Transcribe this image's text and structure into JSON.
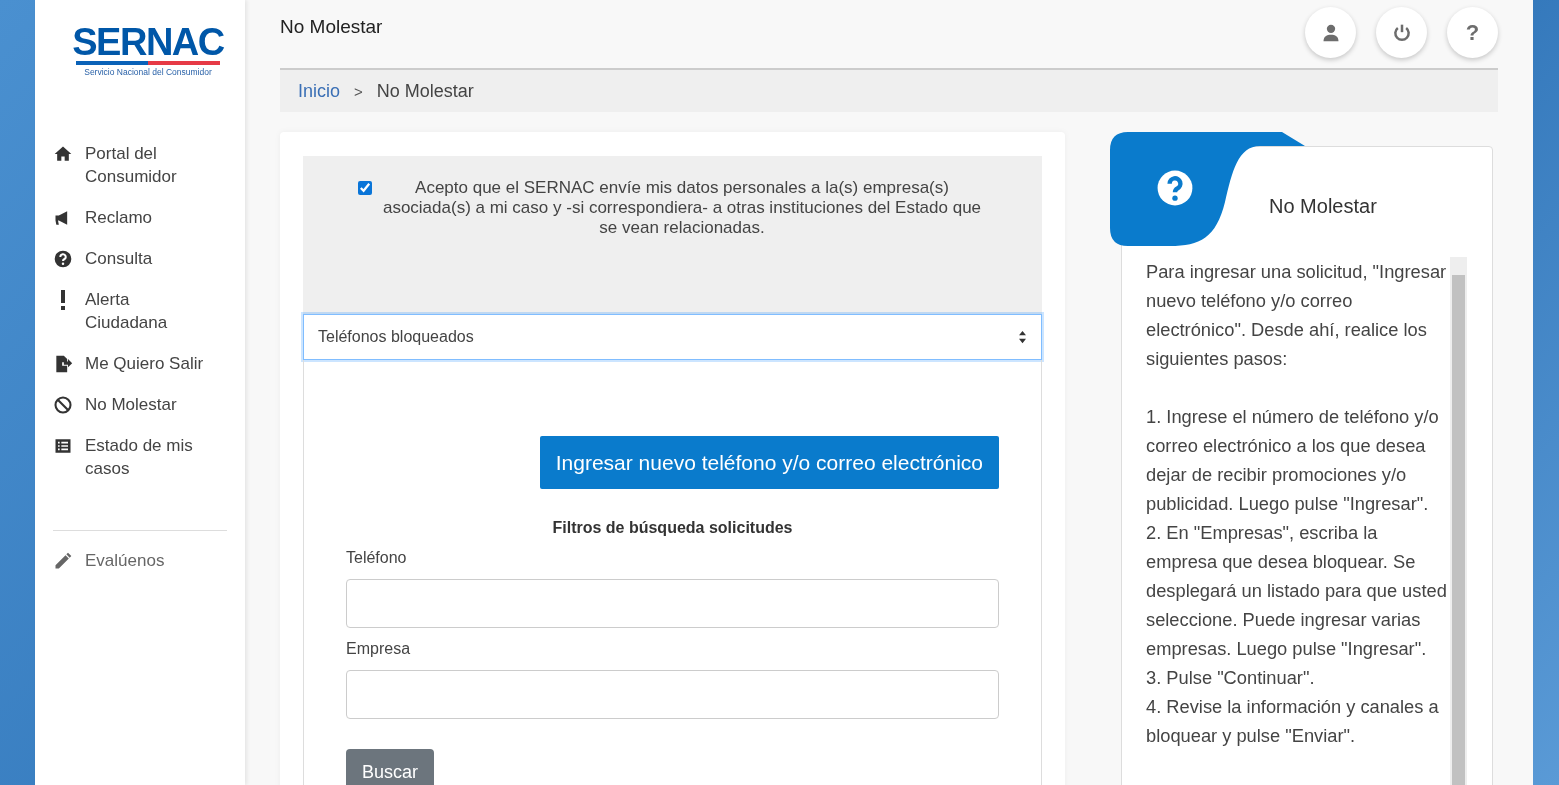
{
  "logo": {
    "title": "SERNAC",
    "subtitle": "Servicio Nacional del Consumidor"
  },
  "sidebar": {
    "items": [
      {
        "kind": "home",
        "label": "Portal del Consumidor"
      },
      {
        "kind": "megaphone",
        "label": "Reclamo"
      },
      {
        "kind": "question",
        "label": "Consulta"
      },
      {
        "kind": "alert",
        "label": "Alerta Ciudadana"
      },
      {
        "kind": "exit",
        "label": "Me Quiero Salir"
      },
      {
        "kind": "ban",
        "label": "No Molestar"
      },
      {
        "kind": "list",
        "label": "Estado de mis casos"
      }
    ],
    "footer_item": {
      "kind": "pencil",
      "label": "Evalúenos"
    }
  },
  "header": {
    "title": "No Molestar",
    "buttons": [
      {
        "kind": "user"
      },
      {
        "kind": "power"
      },
      {
        "kind": "help",
        "label": "?"
      }
    ]
  },
  "breadcrumb": {
    "link": "Inicio",
    "separator": ">",
    "current": "No Molestar"
  },
  "form": {
    "consent": {
      "checked": true,
      "text": "Acepto que el SERNAC envíe mis datos personales a la(s) empresa(s) asociada(s) a mi caso y -si correspondiera- a otras instituciones del Estado que se vean relacionadas."
    },
    "select": {
      "value": "Teléfonos bloqueados"
    },
    "add_button": "Ingresar nuevo teléfono y/o correo electrónico",
    "filters_title": "Filtros de búsqueda solicitudes",
    "fields": [
      {
        "label": "Teléfono"
      },
      {
        "label": "Empresa"
      }
    ],
    "search_button": "Buscar"
  },
  "help": {
    "title": "No Molestar",
    "intro": "Para ingresar una solicitud, \"Ingresar nuevo teléfono y/o correo electrónico\". Desde ahí, realice los siguientes pasos:",
    "steps": [
      "1. Ingrese el número de teléfono y/o correo electrónico a los que desea dejar de recibir promociones y/o publicidad. Luego pulse \"Ingresar\".",
      "2. En \"Empresas\", escriba la empresa que desea bloquear. Se desplegará un listado para que usted seleccione. Puede ingresar varias empresas. Luego pulse \"Ingresar\".",
      "3. Pulse \"Continuar\".",
      "4. Revise la información y canales a bloquear y pulse \"Enviar\"."
    ]
  }
}
